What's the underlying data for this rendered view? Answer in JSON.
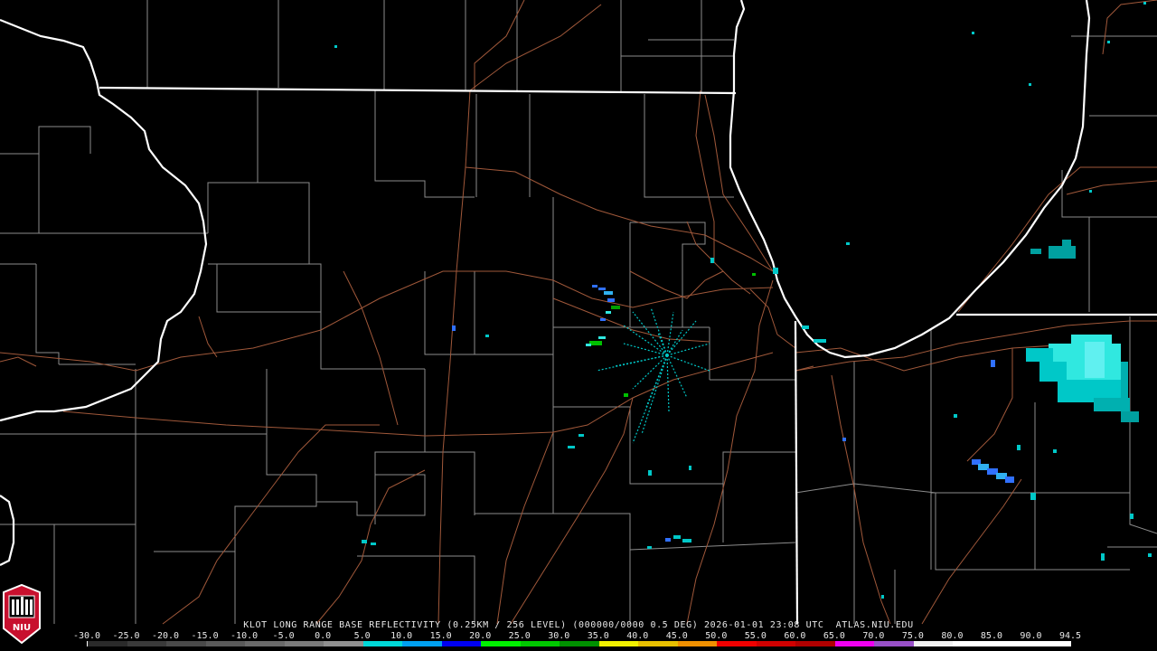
{
  "product": {
    "caption": "KLOT LONG RANGE BASE REFLECTIVITY (0.25KM / 256 LEVEL) (000000/0000 0.5 DEG) 2026-01-01 23:08 UTC  ATLAS.NIU.EDU"
  },
  "logo": {
    "text": "NIU",
    "color": "#c8102e"
  },
  "colors": {
    "background": "#000000",
    "state_border": "#ffffff",
    "county_border": "#8c8c8c",
    "highway": "#a0583a",
    "echo_light": "#00c8c8",
    "echo_cyan": "#30e8e0",
    "echo_blue": "#3070ff",
    "echo_green": "#00c000"
  },
  "scale": {
    "labels": [
      "-30.0",
      "-25.0",
      "-20.0",
      "-15.0",
      "-10.0",
      "-5.0",
      "0.0",
      "5.0",
      "10.0",
      "15.0",
      "20.0",
      "25.0",
      "30.0",
      "35.0",
      "40.0",
      "45.0",
      "50.0",
      "55.0",
      "60.0",
      "65.0",
      "70.0",
      "75.0",
      "80.0",
      "85.0",
      "90.0",
      "94.5"
    ],
    "colors": [
      "#2a2a2a",
      "#3a3a3a",
      "#4a4a4a",
      "#5a5a5a",
      "#6a6a6a",
      "#7a7a7a",
      "#909090",
      "#00d8d8",
      "#00a0f0",
      "#0000f0",
      "#00f000",
      "#00c800",
      "#009000",
      "#f0f000",
      "#e8c000",
      "#f09000",
      "#f00000",
      "#d00000",
      "#b00000",
      "#f000f0",
      "#9850c8",
      "#f0f0f0",
      "#ffffff",
      "#ffffff",
      "#ffffff"
    ]
  }
}
